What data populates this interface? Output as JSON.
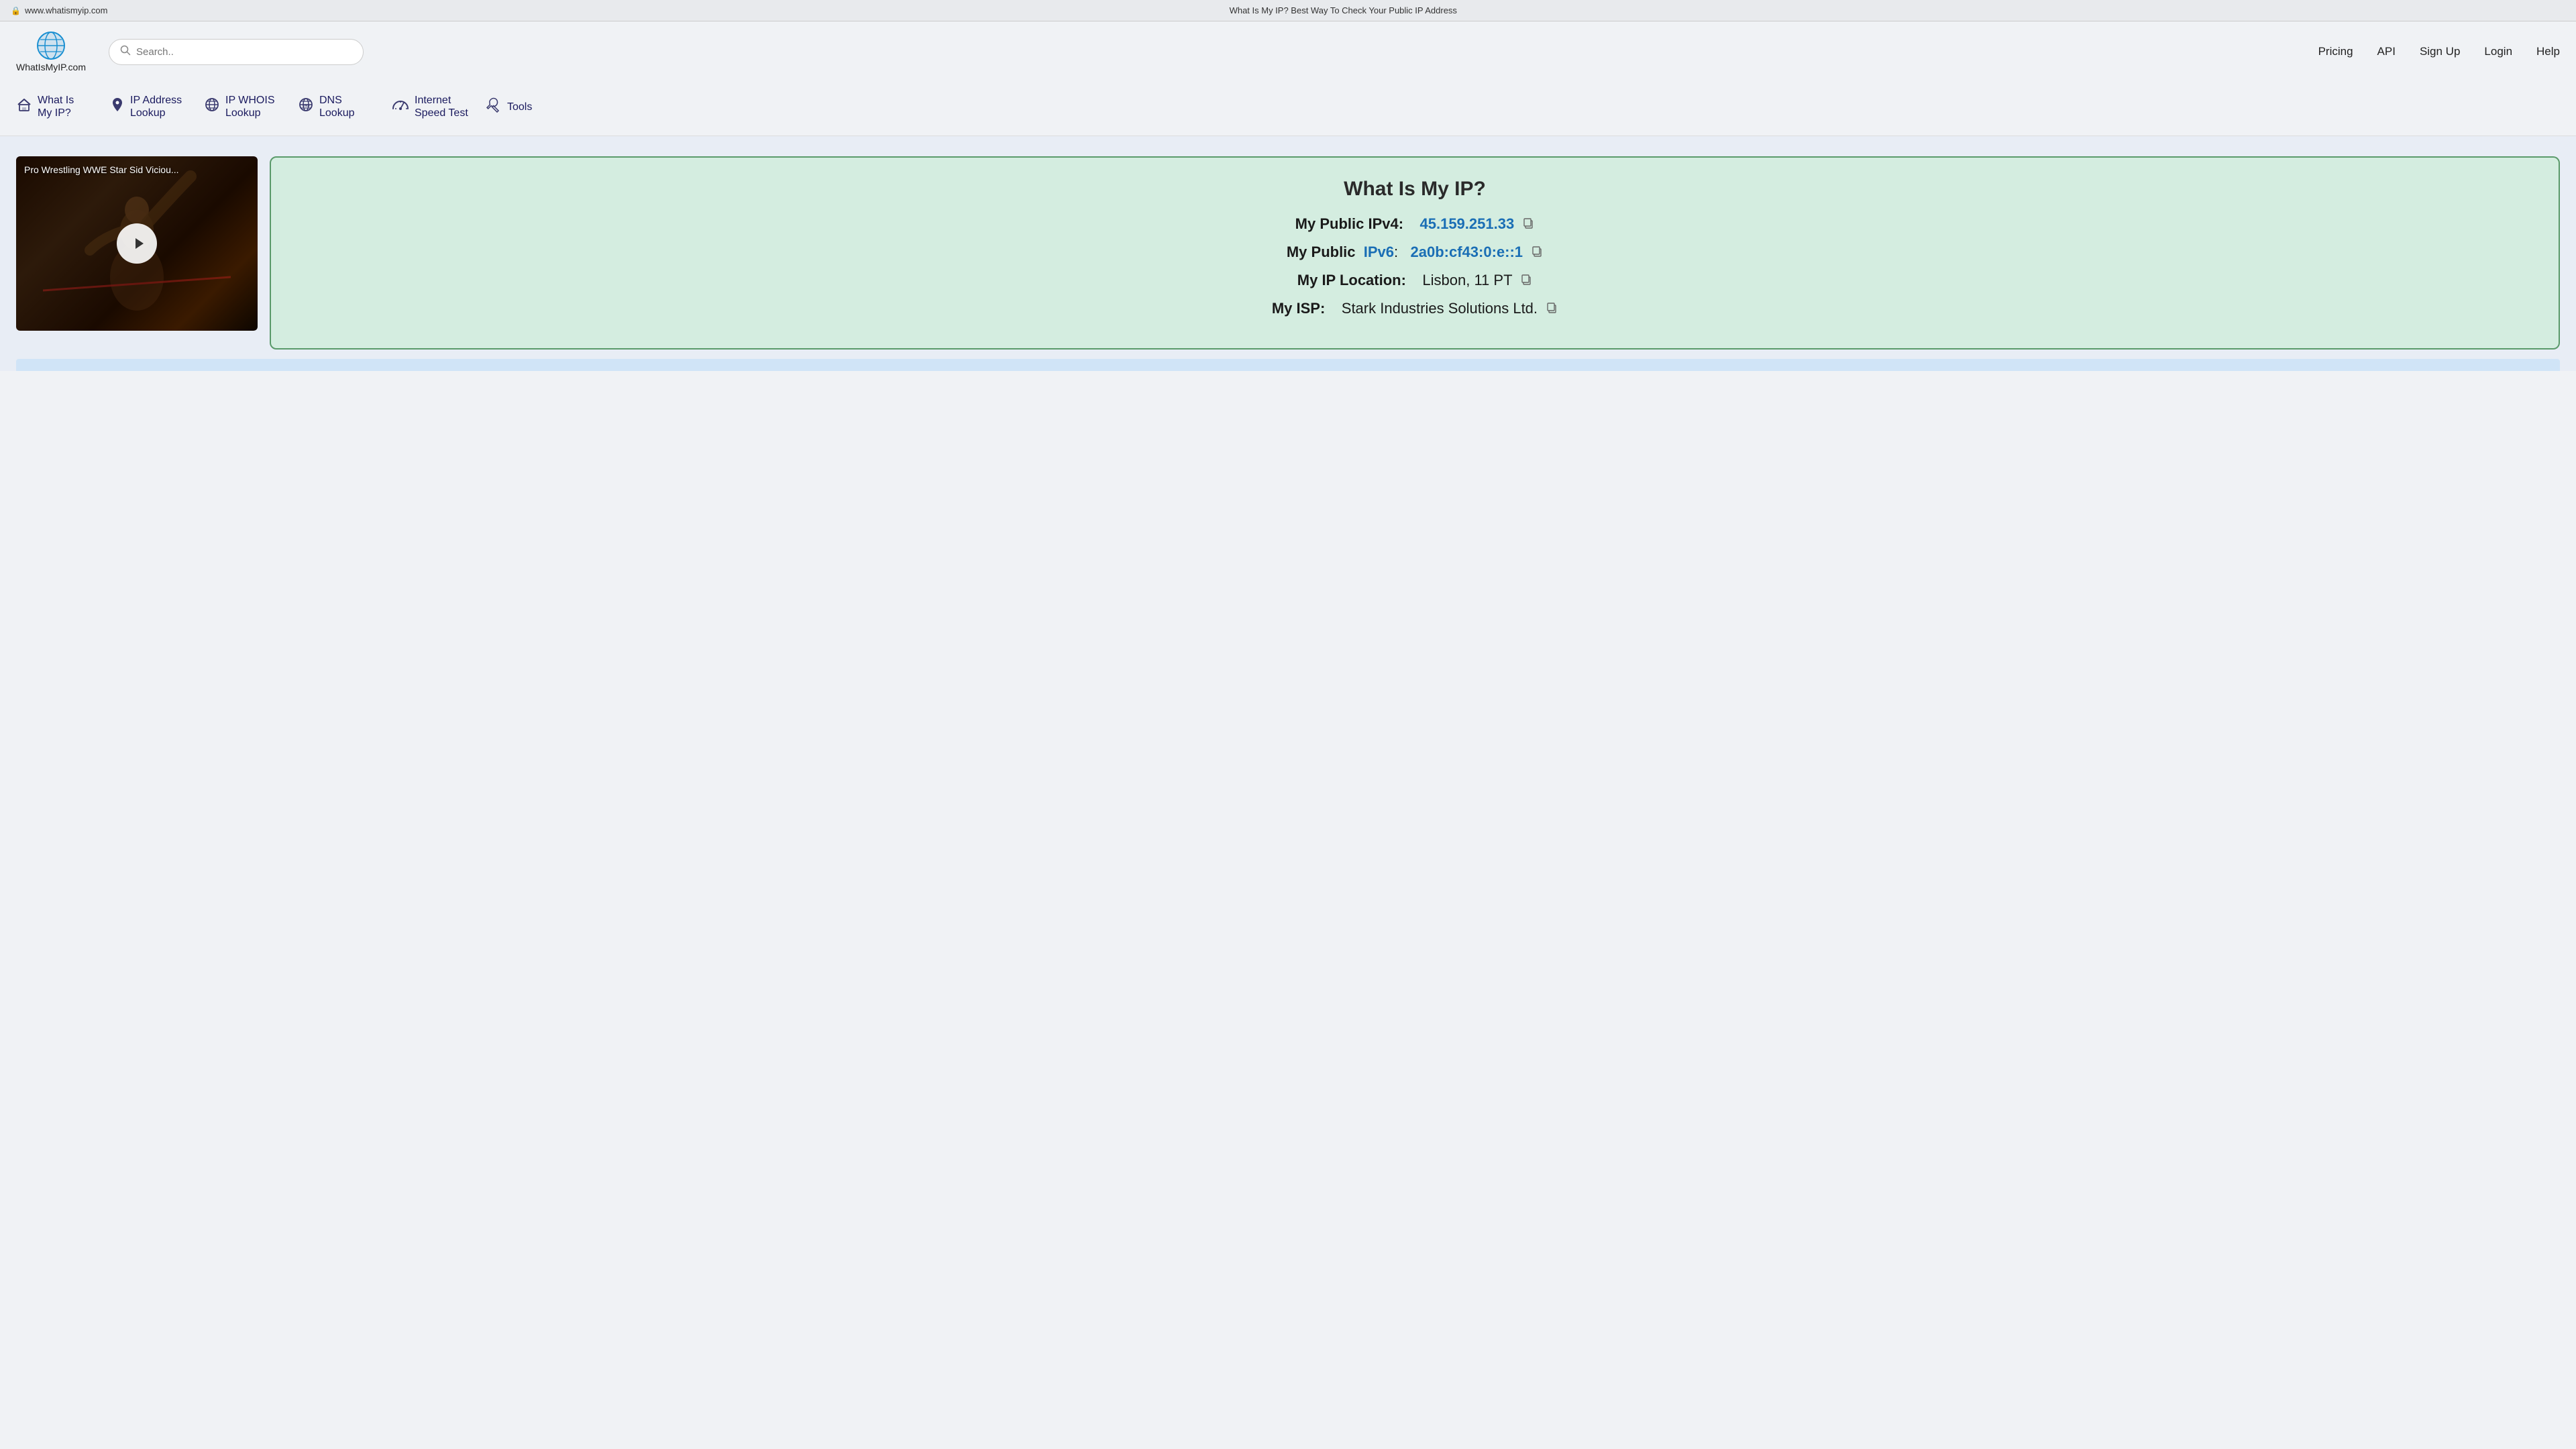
{
  "browser": {
    "url": "www.whatismyip.com",
    "page_title": "What Is My IP? Best Way To Check Your Public IP Address",
    "lock_icon": "🔒"
  },
  "header": {
    "logo_text": "WhatIsMyIP.com",
    "search_placeholder": "Search..",
    "nav": {
      "pricing": "Pricing",
      "api": "API",
      "signup": "Sign Up",
      "login": "Login",
      "help": "Help"
    }
  },
  "secondary_nav": [
    {
      "id": "what-is-my-ip",
      "icon": "🏠",
      "label": "What Is\nMy IP?"
    },
    {
      "id": "ip-address-lookup",
      "icon": "📍",
      "label": "IP Address\nLookup"
    },
    {
      "id": "ip-whois-lookup",
      "icon": "🌐",
      "label": "IP WHOIS\nLookup"
    },
    {
      "id": "dns-lookup",
      "icon": "🌐",
      "label": "DNS\nLookup"
    },
    {
      "id": "internet-speed-test",
      "icon": "⏱",
      "label": "Internet\nSpeed Test"
    },
    {
      "id": "tools",
      "icon": "🔧",
      "label": "Tools"
    }
  ],
  "video": {
    "label": "Pro Wrestling WWE Star Sid Viciou..."
  },
  "ip_info": {
    "title": "What Is My IP?",
    "ipv4_label": "My Public IPv4:",
    "ipv4_value": "45.159.251.33",
    "ipv6_label": "My Public",
    "ipv6_link_label": "IPv6",
    "ipv6_colon": ":",
    "ipv6_value": "2a0b:cf43:0:e::1",
    "location_label": "My IP Location:",
    "location_value": "Lisbon, 11 PT",
    "isp_label": "My ISP:",
    "isp_value": "Stark Industries Solutions Ltd."
  }
}
